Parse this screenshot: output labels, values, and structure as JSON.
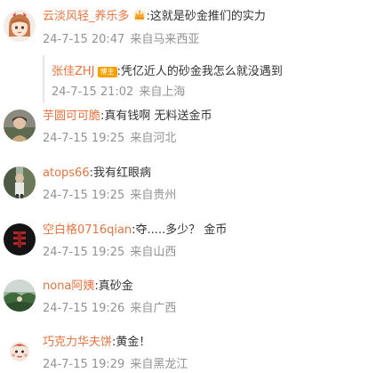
{
  "comments": [
    {
      "username": "云淡风轻_养乐多",
      "text": ":这就是砂金推们的实力",
      "time": "24-7-15 20:47",
      "location": "来自马来西亚",
      "avatar_icon": "anime-girl-avatar",
      "badge_icon": "crown-icon",
      "reply": {
        "username": "张佳ZHJ",
        "badge": "博主",
        "text": ":凭亿近人的砂金我怎么就没遇到",
        "time": "24-7-15 21:02",
        "location": "来自上海"
      }
    },
    {
      "username": "芋圆可可脆",
      "text": ":真有钱啊 无料送金币",
      "time": "24-7-15 19:25",
      "location": "来自河北",
      "avatar_icon": "person-photo-avatar"
    },
    {
      "username": "atops66",
      "text": ":我有红眼病",
      "time": "24-7-15 19:25",
      "location": "来自贵州",
      "avatar_icon": "outdoor-photo-avatar"
    },
    {
      "username": "空白格0716qian",
      "text": ":夺.....多少？ 金币",
      "time": "24-7-15 19:25",
      "location": "来自山西",
      "avatar_icon": "dark-red-avatar"
    },
    {
      "username": "nona阿姨",
      "text": ":真砂金",
      "time": "24-7-15 19:26",
      "location": "来自广西",
      "avatar_icon": "landscape-avatar"
    },
    {
      "username": "巧克力华夫饼",
      "text": ":黄金！",
      "time": "24-7-15 19:29",
      "location": "来自黑龙江",
      "avatar_icon": "cartoon-avatar"
    }
  ],
  "colors": {
    "username": "#eb7340",
    "meta": "#939393",
    "badge": "#f7a000"
  }
}
